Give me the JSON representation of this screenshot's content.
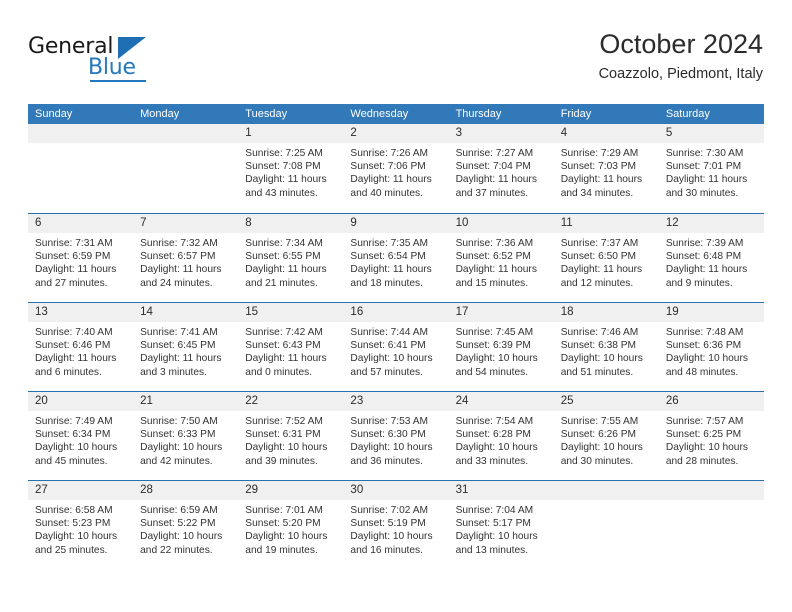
{
  "brand": {
    "name_top": "General",
    "name_bottom": "Blue",
    "accent_color": "#2478bd"
  },
  "header": {
    "title": "October 2024",
    "location": "Coazzolo, Piedmont, Italy"
  },
  "theme": {
    "header_row_bg": "#3179b9",
    "week_separator": "#2c6fb0",
    "day_band_bg": "#f0f0f0",
    "text_color": "#333333"
  },
  "weekdays": [
    "Sunday",
    "Monday",
    "Tuesday",
    "Wednesday",
    "Thursday",
    "Friday",
    "Saturday"
  ],
  "weeks": [
    [
      {
        "day": "",
        "sunrise": "",
        "sunset": "",
        "daylight_1": "",
        "daylight_2": ""
      },
      {
        "day": "",
        "sunrise": "",
        "sunset": "",
        "daylight_1": "",
        "daylight_2": ""
      },
      {
        "day": "1",
        "sunrise": "Sunrise: 7:25 AM",
        "sunset": "Sunset: 7:08 PM",
        "daylight_1": "Daylight: 11 hours",
        "daylight_2": "and 43 minutes."
      },
      {
        "day": "2",
        "sunrise": "Sunrise: 7:26 AM",
        "sunset": "Sunset: 7:06 PM",
        "daylight_1": "Daylight: 11 hours",
        "daylight_2": "and 40 minutes."
      },
      {
        "day": "3",
        "sunrise": "Sunrise: 7:27 AM",
        "sunset": "Sunset: 7:04 PM",
        "daylight_1": "Daylight: 11 hours",
        "daylight_2": "and 37 minutes."
      },
      {
        "day": "4",
        "sunrise": "Sunrise: 7:29 AM",
        "sunset": "Sunset: 7:03 PM",
        "daylight_1": "Daylight: 11 hours",
        "daylight_2": "and 34 minutes."
      },
      {
        "day": "5",
        "sunrise": "Sunrise: 7:30 AM",
        "sunset": "Sunset: 7:01 PM",
        "daylight_1": "Daylight: 11 hours",
        "daylight_2": "and 30 minutes."
      }
    ],
    [
      {
        "day": "6",
        "sunrise": "Sunrise: 7:31 AM",
        "sunset": "Sunset: 6:59 PM",
        "daylight_1": "Daylight: 11 hours",
        "daylight_2": "and 27 minutes."
      },
      {
        "day": "7",
        "sunrise": "Sunrise: 7:32 AM",
        "sunset": "Sunset: 6:57 PM",
        "daylight_1": "Daylight: 11 hours",
        "daylight_2": "and 24 minutes."
      },
      {
        "day": "8",
        "sunrise": "Sunrise: 7:34 AM",
        "sunset": "Sunset: 6:55 PM",
        "daylight_1": "Daylight: 11 hours",
        "daylight_2": "and 21 minutes."
      },
      {
        "day": "9",
        "sunrise": "Sunrise: 7:35 AM",
        "sunset": "Sunset: 6:54 PM",
        "daylight_1": "Daylight: 11 hours",
        "daylight_2": "and 18 minutes."
      },
      {
        "day": "10",
        "sunrise": "Sunrise: 7:36 AM",
        "sunset": "Sunset: 6:52 PM",
        "daylight_1": "Daylight: 11 hours",
        "daylight_2": "and 15 minutes."
      },
      {
        "day": "11",
        "sunrise": "Sunrise: 7:37 AM",
        "sunset": "Sunset: 6:50 PM",
        "daylight_1": "Daylight: 11 hours",
        "daylight_2": "and 12 minutes."
      },
      {
        "day": "12",
        "sunrise": "Sunrise: 7:39 AM",
        "sunset": "Sunset: 6:48 PM",
        "daylight_1": "Daylight: 11 hours",
        "daylight_2": "and 9 minutes."
      }
    ],
    [
      {
        "day": "13",
        "sunrise": "Sunrise: 7:40 AM",
        "sunset": "Sunset: 6:46 PM",
        "daylight_1": "Daylight: 11 hours",
        "daylight_2": "and 6 minutes."
      },
      {
        "day": "14",
        "sunrise": "Sunrise: 7:41 AM",
        "sunset": "Sunset: 6:45 PM",
        "daylight_1": "Daylight: 11 hours",
        "daylight_2": "and 3 minutes."
      },
      {
        "day": "15",
        "sunrise": "Sunrise: 7:42 AM",
        "sunset": "Sunset: 6:43 PM",
        "daylight_1": "Daylight: 11 hours",
        "daylight_2": "and 0 minutes."
      },
      {
        "day": "16",
        "sunrise": "Sunrise: 7:44 AM",
        "sunset": "Sunset: 6:41 PM",
        "daylight_1": "Daylight: 10 hours",
        "daylight_2": "and 57 minutes."
      },
      {
        "day": "17",
        "sunrise": "Sunrise: 7:45 AM",
        "sunset": "Sunset: 6:39 PM",
        "daylight_1": "Daylight: 10 hours",
        "daylight_2": "and 54 minutes."
      },
      {
        "day": "18",
        "sunrise": "Sunrise: 7:46 AM",
        "sunset": "Sunset: 6:38 PM",
        "daylight_1": "Daylight: 10 hours",
        "daylight_2": "and 51 minutes."
      },
      {
        "day": "19",
        "sunrise": "Sunrise: 7:48 AM",
        "sunset": "Sunset: 6:36 PM",
        "daylight_1": "Daylight: 10 hours",
        "daylight_2": "and 48 minutes."
      }
    ],
    [
      {
        "day": "20",
        "sunrise": "Sunrise: 7:49 AM",
        "sunset": "Sunset: 6:34 PM",
        "daylight_1": "Daylight: 10 hours",
        "daylight_2": "and 45 minutes."
      },
      {
        "day": "21",
        "sunrise": "Sunrise: 7:50 AM",
        "sunset": "Sunset: 6:33 PM",
        "daylight_1": "Daylight: 10 hours",
        "daylight_2": "and 42 minutes."
      },
      {
        "day": "22",
        "sunrise": "Sunrise: 7:52 AM",
        "sunset": "Sunset: 6:31 PM",
        "daylight_1": "Daylight: 10 hours",
        "daylight_2": "and 39 minutes."
      },
      {
        "day": "23",
        "sunrise": "Sunrise: 7:53 AM",
        "sunset": "Sunset: 6:30 PM",
        "daylight_1": "Daylight: 10 hours",
        "daylight_2": "and 36 minutes."
      },
      {
        "day": "24",
        "sunrise": "Sunrise: 7:54 AM",
        "sunset": "Sunset: 6:28 PM",
        "daylight_1": "Daylight: 10 hours",
        "daylight_2": "and 33 minutes."
      },
      {
        "day": "25",
        "sunrise": "Sunrise: 7:55 AM",
        "sunset": "Sunset: 6:26 PM",
        "daylight_1": "Daylight: 10 hours",
        "daylight_2": "and 30 minutes."
      },
      {
        "day": "26",
        "sunrise": "Sunrise: 7:57 AM",
        "sunset": "Sunset: 6:25 PM",
        "daylight_1": "Daylight: 10 hours",
        "daylight_2": "and 28 minutes."
      }
    ],
    [
      {
        "day": "27",
        "sunrise": "Sunrise: 6:58 AM",
        "sunset": "Sunset: 5:23 PM",
        "daylight_1": "Daylight: 10 hours",
        "daylight_2": "and 25 minutes."
      },
      {
        "day": "28",
        "sunrise": "Sunrise: 6:59 AM",
        "sunset": "Sunset: 5:22 PM",
        "daylight_1": "Daylight: 10 hours",
        "daylight_2": "and 22 minutes."
      },
      {
        "day": "29",
        "sunrise": "Sunrise: 7:01 AM",
        "sunset": "Sunset: 5:20 PM",
        "daylight_1": "Daylight: 10 hours",
        "daylight_2": "and 19 minutes."
      },
      {
        "day": "30",
        "sunrise": "Sunrise: 7:02 AM",
        "sunset": "Sunset: 5:19 PM",
        "daylight_1": "Daylight: 10 hours",
        "daylight_2": "and 16 minutes."
      },
      {
        "day": "31",
        "sunrise": "Sunrise: 7:04 AM",
        "sunset": "Sunset: 5:17 PM",
        "daylight_1": "Daylight: 10 hours",
        "daylight_2": "and 13 minutes."
      },
      {
        "day": "",
        "sunrise": "",
        "sunset": "",
        "daylight_1": "",
        "daylight_2": ""
      },
      {
        "day": "",
        "sunrise": "",
        "sunset": "",
        "daylight_1": "",
        "daylight_2": ""
      }
    ]
  ]
}
